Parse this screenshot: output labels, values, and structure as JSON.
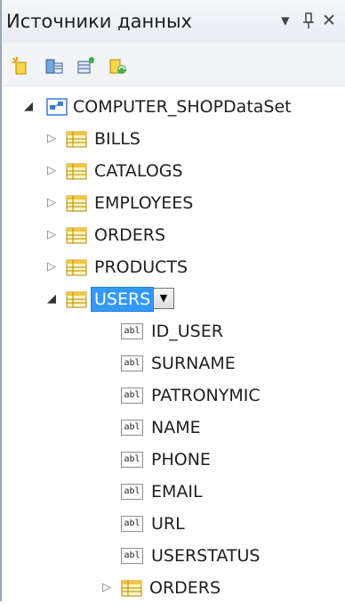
{
  "panel": {
    "title": "Источники данных",
    "controls": {
      "dropdown": "▾",
      "pin": "ꟷ",
      "close": "✕"
    }
  },
  "toolbar": {
    "buttons": [
      {
        "name": "add-datasource-icon"
      },
      {
        "name": "edit-dataset-designer-icon"
      },
      {
        "name": "configure-dataset-wizard-icon"
      },
      {
        "name": "refresh-icon"
      }
    ]
  },
  "tree": {
    "root": {
      "label": "COMPUTER_SHOPDataSet",
      "expanded": true
    },
    "tables": [
      {
        "label": "BILLS",
        "expanded": false
      },
      {
        "label": "CATALOGS",
        "expanded": false
      },
      {
        "label": "EMPLOYEES",
        "expanded": false
      },
      {
        "label": "ORDERS",
        "expanded": false
      },
      {
        "label": "PRODUCTS",
        "expanded": false
      },
      {
        "label": "USERS",
        "expanded": true,
        "selected": true
      }
    ],
    "user_fields": [
      {
        "label": "ID_USER",
        "icon": "abl"
      },
      {
        "label": "SURNAME",
        "icon": "abl"
      },
      {
        "label": "PATRONYMIC",
        "icon": "abl"
      },
      {
        "label": "NAME",
        "icon": "abl"
      },
      {
        "label": "PHONE",
        "icon": "abl"
      },
      {
        "label": "EMAIL",
        "icon": "abl"
      },
      {
        "label": "URL",
        "icon": "abl"
      },
      {
        "label": "USERSTATUS",
        "icon": "abl"
      }
    ],
    "user_relations": [
      {
        "label": "ORDERS",
        "expanded": false
      }
    ]
  },
  "colors": {
    "selection": "#3399ff",
    "table_icon": "#f5c542",
    "dataset_icon": "#3a7bd5"
  }
}
